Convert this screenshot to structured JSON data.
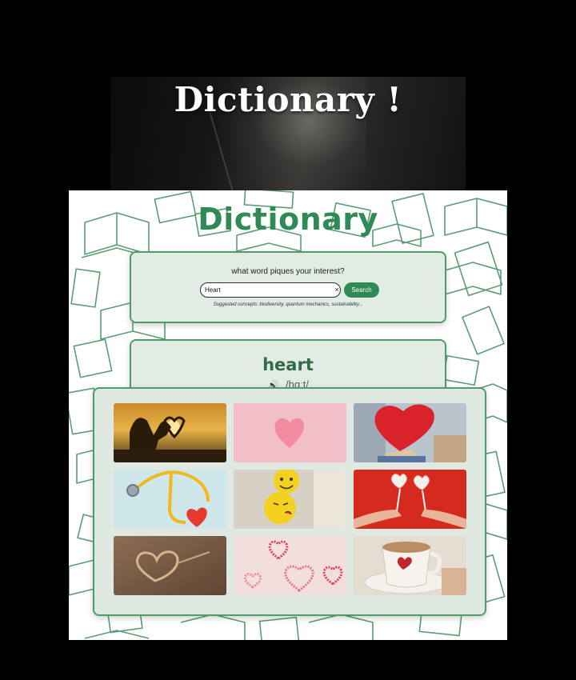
{
  "banner": {
    "title": "Dictionary !"
  },
  "app": {
    "title": "Dictionary",
    "search": {
      "prompt": "what word piques your interest?",
      "value": "Heart",
      "button_label": "Search",
      "clear_symbol": "×",
      "suggestions": "Suggested concepts: biodiversity, quantum mechanics, sustainability..."
    },
    "result": {
      "word": "heart",
      "phonetic": "/hɑːt/"
    },
    "gallery": {
      "images": [
        {
          "name": "sunset-heart-hands-image"
        },
        {
          "name": "pink-felt-heart-image"
        },
        {
          "name": "red-heart-balloon-image"
        },
        {
          "name": "stethoscope-heart-image"
        },
        {
          "name": "emoji-balloons-image"
        },
        {
          "name": "heart-lollipops-image"
        },
        {
          "name": "sand-heart-image"
        },
        {
          "name": "beaded-hearts-image"
        },
        {
          "name": "coffee-cup-heart-image"
        }
      ]
    }
  },
  "colors": {
    "accent": "#2f8a55",
    "card_bg": "#e2ebe4",
    "card_border": "#4f9c6b"
  }
}
